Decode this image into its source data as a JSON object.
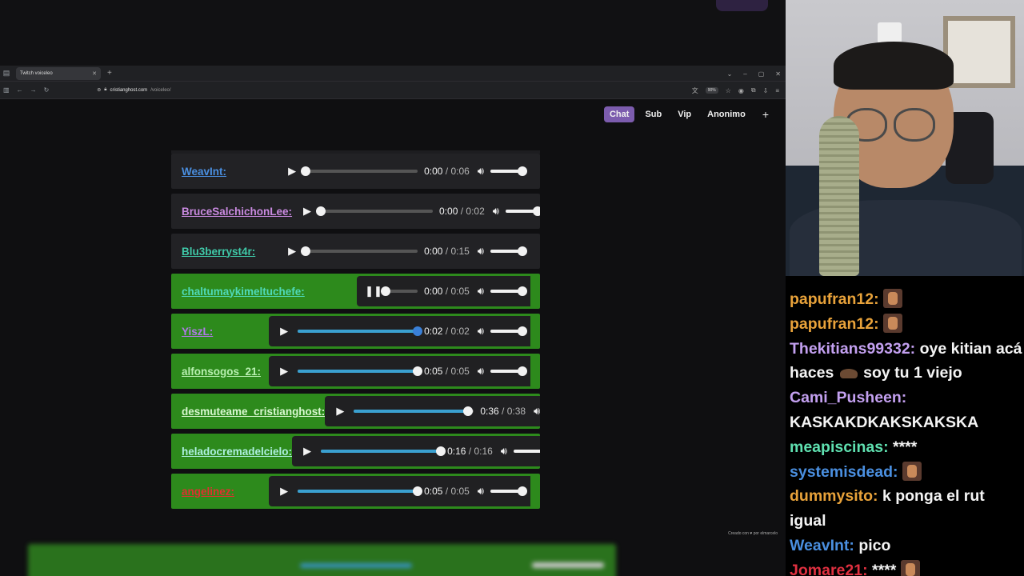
{
  "browser": {
    "tab_title": "Twitch voiceleo",
    "url_host": "cristianghost.com",
    "url_path": "/voiceleo/",
    "zoom": "90%"
  },
  "nav": {
    "chat": "Chat",
    "sub": "Sub",
    "vip": "Vip",
    "anonimo": "Anonimo",
    "plus": "+"
  },
  "rows": [
    {
      "user": "WeavInt:",
      "color": "#4a8fe0",
      "green": false,
      "state": "play",
      "progress": 0,
      "current": "0:00",
      "duration": "0:06"
    },
    {
      "user": "BruceSalchichonLee:",
      "color": "#c98ae0",
      "green": false,
      "state": "play",
      "progress": 0,
      "current": "0:00",
      "duration": "0:02"
    },
    {
      "user": "Blu3berryst4r:",
      "color": "#3fc9a8",
      "green": false,
      "state": "play",
      "progress": 0,
      "current": "0:00",
      "duration": "0:15"
    },
    {
      "user": "chaltumaykimeltuchefe:",
      "color": "#4fd9b8",
      "green": true,
      "state": "pause",
      "progress": 0,
      "current": "0:00",
      "duration": "0:05"
    },
    {
      "user": "YiszL:",
      "color": "#b07ae8",
      "green": true,
      "state": "play",
      "progress": 1,
      "current": "0:02",
      "duration": "0:02"
    },
    {
      "user": "alfonsogos_21:",
      "color": "#b8f0b0",
      "green": true,
      "state": "play",
      "progress": 1,
      "current": "0:05",
      "duration": "0:05"
    },
    {
      "user": "desmuteame_cristianghost:",
      "color": "#d8f8d0",
      "green": true,
      "state": "play",
      "progress": 0.95,
      "current": "0:36",
      "duration": "0:38"
    },
    {
      "user": "heladocremadelcielo:",
      "color": "#aef0e0",
      "green": true,
      "state": "play",
      "progress": 1,
      "current": "0:16",
      "duration": "0:16"
    },
    {
      "user": "angelinez:",
      "color": "#e03030",
      "green": true,
      "state": "play",
      "progress": 1,
      "current": "0:05",
      "duration": "0:05"
    }
  ],
  "credit": "Creado con ♥ por elmarcelo",
  "chat": {
    "messages": [
      {
        "user": "papufran12:",
        "color": "#e8a23a",
        "text": "",
        "emote": "hero"
      },
      {
        "user": "papufran12:",
        "color": "#e8a23a",
        "text": "",
        "emote": "hero"
      },
      {
        "user": "Thekitians99332:",
        "color": "#c3a0f0",
        "text": "oye kitian acá haces",
        "emote": "pile",
        "text2": "soy tu 1 viejo"
      },
      {
        "user": "Cami_Pusheen:",
        "color": "#c3a0f0",
        "text": "KASKAKDKAKSKAKSKA",
        "emote": ""
      },
      {
        "user": "meapiscinas:",
        "color": "#5fe0b0",
        "text": "****",
        "emote": ""
      },
      {
        "user": "systemisdead:",
        "color": "#4a8fe0",
        "text": "",
        "emote": "hero"
      },
      {
        "user": "dummysito:",
        "color": "#e8a23a",
        "text": "k ponga el rut igual",
        "emote": ""
      },
      {
        "user": "WeavInt:",
        "color": "#4a8fe0",
        "text": "pico",
        "emote": ""
      },
      {
        "user": "Jomare21:",
        "color": "#e03040",
        "text": "****",
        "emote": "hero"
      }
    ]
  }
}
